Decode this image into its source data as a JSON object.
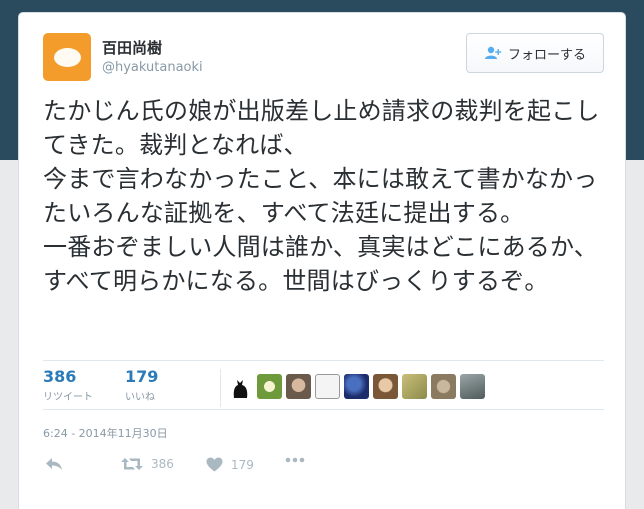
{
  "user": {
    "display_name": "百田尚樹",
    "screen_name": "@hyakutanaoki",
    "follow_label": "フォローする"
  },
  "tweet": {
    "text": "たかじん氏の娘が出版差し止め請求の裁判を起こしてきた。裁判となれば、\n今まで言わなかったこと、本には敢えて書かなかったいろんな証拠を、すべて法廷に提出する。\n一番おぞましい人間は誰か、真実はどこにあるか、すべて明らかになる。世間はびっくりするぞ。",
    "timestamp": "6:24 - 2014年11月30日"
  },
  "stats": {
    "retweets": {
      "count": "386",
      "label": "リツイート"
    },
    "likes": {
      "count": "179",
      "label": "いいね"
    }
  },
  "actions": {
    "retweet_count": "386",
    "like_count": "179"
  },
  "icons": {
    "follow": "add-user-icon",
    "reply": "reply-icon",
    "retweet": "retweet-icon",
    "like": "heart-icon",
    "more": "more-icon"
  },
  "colors": {
    "link_blue": "#2b7bb9",
    "muted": "#8899a6",
    "text": "#292f33",
    "avatar_bg": "#f39c2b"
  }
}
